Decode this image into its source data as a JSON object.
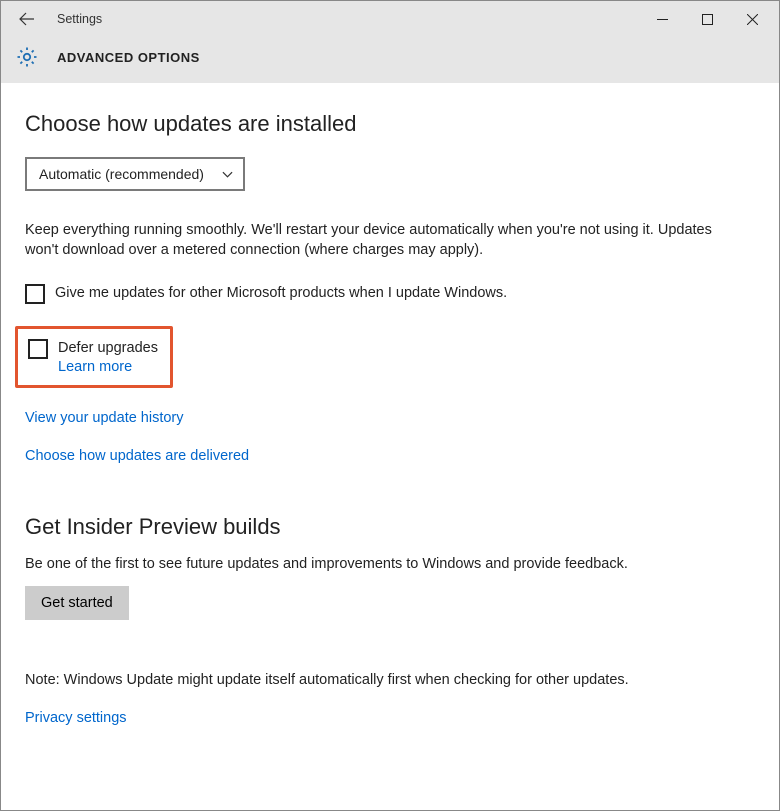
{
  "titlebar": {
    "title": "Settings"
  },
  "subheader": {
    "title": "ADVANCED OPTIONS"
  },
  "section1": {
    "heading": "Choose how updates are installed",
    "dropdown_value": "Automatic (recommended)",
    "description": "Keep everything running smoothly. We'll restart your device automatically when you're not using it. Updates won't download over a metered connection (where charges may apply).",
    "checkbox1_label": "Give me updates for other Microsoft products when I update Windows.",
    "checkbox2_label": "Defer upgrades",
    "checkbox2_link": "Learn more",
    "link1": "View your update history",
    "link2": "Choose how updates are delivered"
  },
  "section2": {
    "heading": "Get Insider Preview builds",
    "description": "Be one of the first to see future updates and improvements to Windows and provide feedback.",
    "button_label": "Get started"
  },
  "note": "Note: Windows Update might update itself automatically first when checking for other updates.",
  "privacy_link": "Privacy settings"
}
